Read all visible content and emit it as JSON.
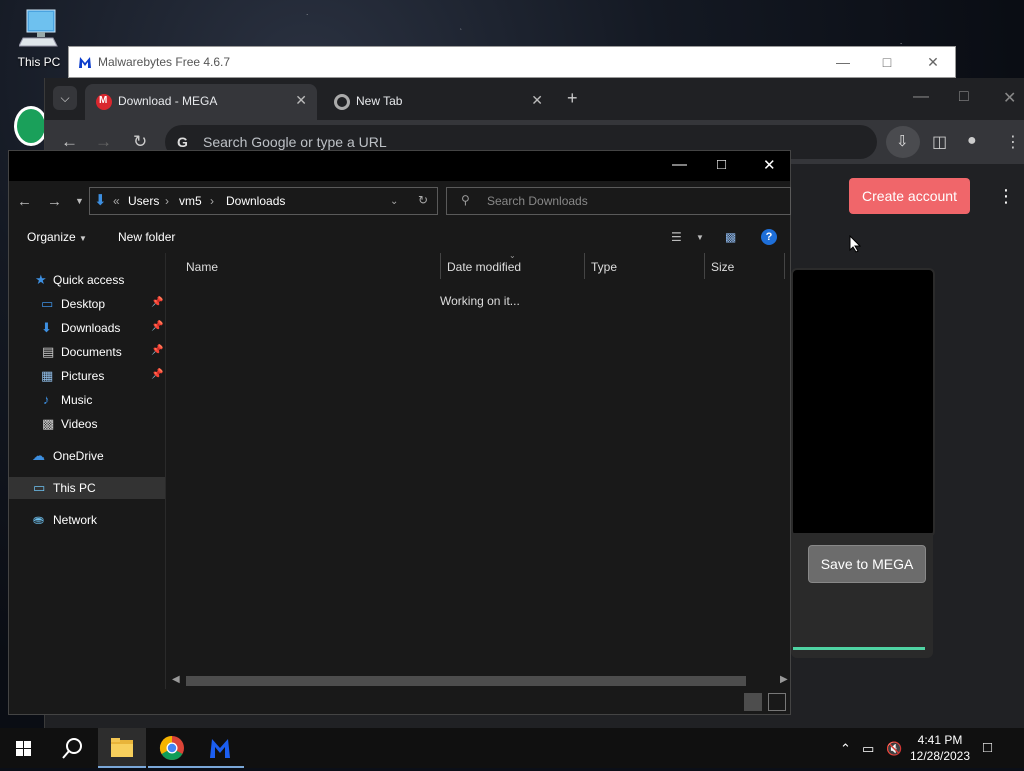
{
  "desktop": {
    "this_pc_label": "This PC"
  },
  "malwarebytes": {
    "title": "Malwarebytes Free 4.6.7"
  },
  "chrome": {
    "tabs": [
      {
        "label": "Download - MEGA",
        "active": true
      },
      {
        "label": "New Tab",
        "active": false
      }
    ],
    "omnibox_placeholder": "Search Google or type a URL"
  },
  "mega": {
    "create_account": "Create account",
    "save_to_mega": "Save to MEGA"
  },
  "explorer": {
    "breadcrumb": [
      "Users",
      "vm5",
      "Downloads"
    ],
    "breadcrumb_prefix": "«",
    "search_placeholder": "Search Downloads",
    "organize": "Organize",
    "new_folder": "New folder",
    "nav": {
      "quick_access": "Quick access",
      "desktop": "Desktop",
      "downloads": "Downloads",
      "documents": "Documents",
      "pictures": "Pictures",
      "music": "Music",
      "videos": "Videos",
      "onedrive": "OneDrive",
      "this_pc": "This PC",
      "network": "Network"
    },
    "columns": [
      "Name",
      "Date modified",
      "Type",
      "Size"
    ],
    "status_message": "Working on it..."
  },
  "taskbar": {
    "time": "4:41 PM",
    "date": "12/28/2023"
  },
  "colors": {
    "mega_red": "#f0666a",
    "accent_blue": "#1e6fd9",
    "progress_green": "#4fd3a3"
  }
}
